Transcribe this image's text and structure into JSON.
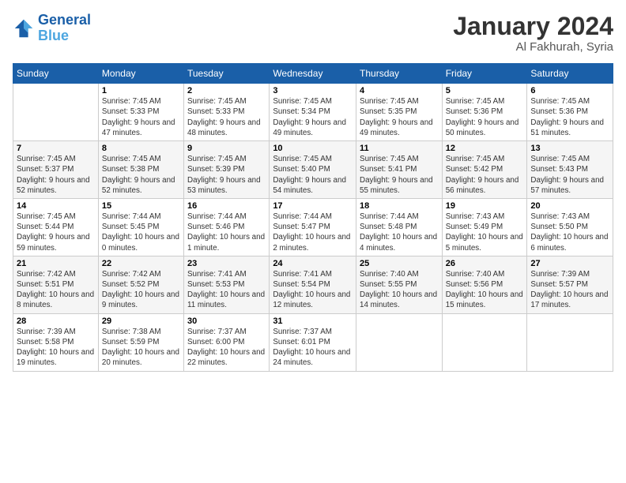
{
  "header": {
    "logo_general": "General",
    "logo_blue": "Blue",
    "month_title": "January 2024",
    "location": "Al Fakhurah, Syria"
  },
  "days_of_week": [
    "Sunday",
    "Monday",
    "Tuesday",
    "Wednesday",
    "Thursday",
    "Friday",
    "Saturday"
  ],
  "weeks": [
    [
      {
        "day": "",
        "sunrise": "",
        "sunset": "",
        "daylight": ""
      },
      {
        "day": "1",
        "sunrise": "Sunrise: 7:45 AM",
        "sunset": "Sunset: 5:33 PM",
        "daylight": "Daylight: 9 hours and 47 minutes."
      },
      {
        "day": "2",
        "sunrise": "Sunrise: 7:45 AM",
        "sunset": "Sunset: 5:33 PM",
        "daylight": "Daylight: 9 hours and 48 minutes."
      },
      {
        "day": "3",
        "sunrise": "Sunrise: 7:45 AM",
        "sunset": "Sunset: 5:34 PM",
        "daylight": "Daylight: 9 hours and 49 minutes."
      },
      {
        "day": "4",
        "sunrise": "Sunrise: 7:45 AM",
        "sunset": "Sunset: 5:35 PM",
        "daylight": "Daylight: 9 hours and 49 minutes."
      },
      {
        "day": "5",
        "sunrise": "Sunrise: 7:45 AM",
        "sunset": "Sunset: 5:36 PM",
        "daylight": "Daylight: 9 hours and 50 minutes."
      },
      {
        "day": "6",
        "sunrise": "Sunrise: 7:45 AM",
        "sunset": "Sunset: 5:36 PM",
        "daylight": "Daylight: 9 hours and 51 minutes."
      }
    ],
    [
      {
        "day": "7",
        "sunrise": "Sunrise: 7:45 AM",
        "sunset": "Sunset: 5:37 PM",
        "daylight": "Daylight: 9 hours and 52 minutes."
      },
      {
        "day": "8",
        "sunrise": "Sunrise: 7:45 AM",
        "sunset": "Sunset: 5:38 PM",
        "daylight": "Daylight: 9 hours and 52 minutes."
      },
      {
        "day": "9",
        "sunrise": "Sunrise: 7:45 AM",
        "sunset": "Sunset: 5:39 PM",
        "daylight": "Daylight: 9 hours and 53 minutes."
      },
      {
        "day": "10",
        "sunrise": "Sunrise: 7:45 AM",
        "sunset": "Sunset: 5:40 PM",
        "daylight": "Daylight: 9 hours and 54 minutes."
      },
      {
        "day": "11",
        "sunrise": "Sunrise: 7:45 AM",
        "sunset": "Sunset: 5:41 PM",
        "daylight": "Daylight: 9 hours and 55 minutes."
      },
      {
        "day": "12",
        "sunrise": "Sunrise: 7:45 AM",
        "sunset": "Sunset: 5:42 PM",
        "daylight": "Daylight: 9 hours and 56 minutes."
      },
      {
        "day": "13",
        "sunrise": "Sunrise: 7:45 AM",
        "sunset": "Sunset: 5:43 PM",
        "daylight": "Daylight: 9 hours and 57 minutes."
      }
    ],
    [
      {
        "day": "14",
        "sunrise": "Sunrise: 7:45 AM",
        "sunset": "Sunset: 5:44 PM",
        "daylight": "Daylight: 9 hours and 59 minutes."
      },
      {
        "day": "15",
        "sunrise": "Sunrise: 7:44 AM",
        "sunset": "Sunset: 5:45 PM",
        "daylight": "Daylight: 10 hours and 0 minutes."
      },
      {
        "day": "16",
        "sunrise": "Sunrise: 7:44 AM",
        "sunset": "Sunset: 5:46 PM",
        "daylight": "Daylight: 10 hours and 1 minute."
      },
      {
        "day": "17",
        "sunrise": "Sunrise: 7:44 AM",
        "sunset": "Sunset: 5:47 PM",
        "daylight": "Daylight: 10 hours and 2 minutes."
      },
      {
        "day": "18",
        "sunrise": "Sunrise: 7:44 AM",
        "sunset": "Sunset: 5:48 PM",
        "daylight": "Daylight: 10 hours and 4 minutes."
      },
      {
        "day": "19",
        "sunrise": "Sunrise: 7:43 AM",
        "sunset": "Sunset: 5:49 PM",
        "daylight": "Daylight: 10 hours and 5 minutes."
      },
      {
        "day": "20",
        "sunrise": "Sunrise: 7:43 AM",
        "sunset": "Sunset: 5:50 PM",
        "daylight": "Daylight: 10 hours and 6 minutes."
      }
    ],
    [
      {
        "day": "21",
        "sunrise": "Sunrise: 7:42 AM",
        "sunset": "Sunset: 5:51 PM",
        "daylight": "Daylight: 10 hours and 8 minutes."
      },
      {
        "day": "22",
        "sunrise": "Sunrise: 7:42 AM",
        "sunset": "Sunset: 5:52 PM",
        "daylight": "Daylight: 10 hours and 9 minutes."
      },
      {
        "day": "23",
        "sunrise": "Sunrise: 7:41 AM",
        "sunset": "Sunset: 5:53 PM",
        "daylight": "Daylight: 10 hours and 11 minutes."
      },
      {
        "day": "24",
        "sunrise": "Sunrise: 7:41 AM",
        "sunset": "Sunset: 5:54 PM",
        "daylight": "Daylight: 10 hours and 12 minutes."
      },
      {
        "day": "25",
        "sunrise": "Sunrise: 7:40 AM",
        "sunset": "Sunset: 5:55 PM",
        "daylight": "Daylight: 10 hours and 14 minutes."
      },
      {
        "day": "26",
        "sunrise": "Sunrise: 7:40 AM",
        "sunset": "Sunset: 5:56 PM",
        "daylight": "Daylight: 10 hours and 15 minutes."
      },
      {
        "day": "27",
        "sunrise": "Sunrise: 7:39 AM",
        "sunset": "Sunset: 5:57 PM",
        "daylight": "Daylight: 10 hours and 17 minutes."
      }
    ],
    [
      {
        "day": "28",
        "sunrise": "Sunrise: 7:39 AM",
        "sunset": "Sunset: 5:58 PM",
        "daylight": "Daylight: 10 hours and 19 minutes."
      },
      {
        "day": "29",
        "sunrise": "Sunrise: 7:38 AM",
        "sunset": "Sunset: 5:59 PM",
        "daylight": "Daylight: 10 hours and 20 minutes."
      },
      {
        "day": "30",
        "sunrise": "Sunrise: 7:37 AM",
        "sunset": "Sunset: 6:00 PM",
        "daylight": "Daylight: 10 hours and 22 minutes."
      },
      {
        "day": "31",
        "sunrise": "Sunrise: 7:37 AM",
        "sunset": "Sunset: 6:01 PM",
        "daylight": "Daylight: 10 hours and 24 minutes."
      },
      {
        "day": "",
        "sunrise": "",
        "sunset": "",
        "daylight": ""
      },
      {
        "day": "",
        "sunrise": "",
        "sunset": "",
        "daylight": ""
      },
      {
        "day": "",
        "sunrise": "",
        "sunset": "",
        "daylight": ""
      }
    ]
  ]
}
